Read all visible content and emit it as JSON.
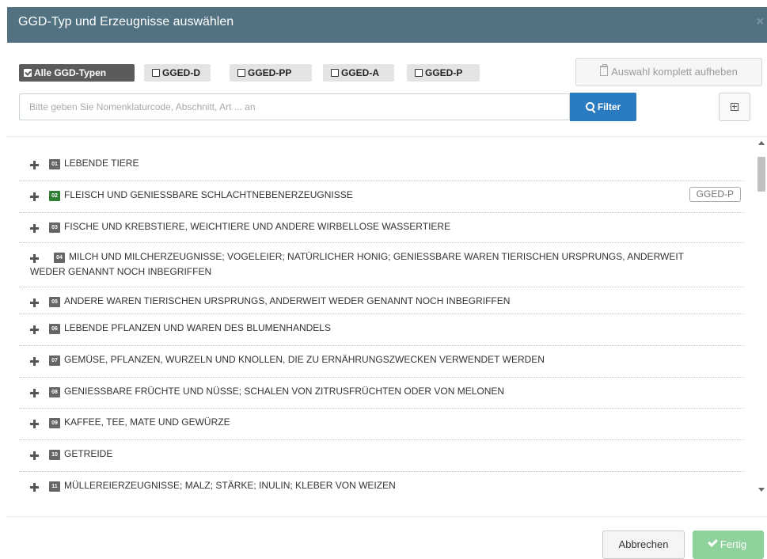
{
  "header": {
    "title": "GGD-Typ und Erzeugnisse auswählen",
    "close": "×"
  },
  "filters": {
    "chips": [
      {
        "label": "Alle GGD-Typen",
        "checked": true
      },
      {
        "label": "GGED-D",
        "checked": false
      },
      {
        "label": "GGED-PP",
        "checked": false
      },
      {
        "label": "GGED-A",
        "checked": false
      },
      {
        "label": "GGED-P",
        "checked": false
      }
    ],
    "clear_all": "Auswahl komplett aufheben"
  },
  "search": {
    "placeholder": "Bitte geben Sie Nomenklaturcode, Abschnitt, Art ... an",
    "value": "",
    "filter_label": "Filter"
  },
  "items": [
    {
      "code": "01",
      "label": "LEBENDE TIERE",
      "code_color": "#666666"
    },
    {
      "code": "02",
      "label": "FLEISCH UND GENIESSBARE SCHLACHTNEBENERZEUGNISSE",
      "code_color": "#2e7d32",
      "tag": "GGED-P"
    },
    {
      "code": "03",
      "label": "FISCHE UND KREBSTIERE, WEICHTIERE UND ANDERE WIRBELLOSE WASSERTIERE"
    },
    {
      "code": "04",
      "label": "MILCH UND MILCHERZEUGNISSE; VOGELEIER; NATÜRLICHER HONIG; GENIESSBARE WAREN TIERISCHEN URSPRUNGS, ANDERWEIT WEDER GENANNT NOCH INBEGRIFFEN"
    },
    {
      "code": "05",
      "label": "ANDERE WAREN TIERISCHEN URSPRUNGS, ANDERWEIT WEDER GENANNT NOCH INBEGRIFFEN"
    },
    {
      "code": "06",
      "label": "LEBENDE PFLANZEN UND WAREN DES BLUMENHANDELS"
    },
    {
      "code": "07",
      "label": "GEMÜSE, PFLANZEN, WURZELN UND KNOLLEN, DIE ZU ERNÄHRUNGSZWECKEN VERWENDET WERDEN"
    },
    {
      "code": "08",
      "label": "GENIESSBARE FRÜCHTE UND NÜSSE; SCHALEN VON ZITRUSFRÜCHTEN ODER VON MELONEN"
    },
    {
      "code": "09",
      "label": "KAFFEE, TEE, MATE UND GEWÜRZE"
    },
    {
      "code": "10",
      "label": "GETREIDE"
    },
    {
      "code": "11",
      "label": "MÜLLEREIERZEUGNISSE; MALZ; STÄRKE; INULIN; KLEBER VON WEIZEN"
    }
  ],
  "footer": {
    "cancel": "Abbrechen",
    "done": "Fertig"
  },
  "colors": {
    "header_bg": "#527281",
    "primary": "#2a7bbf",
    "success": "#8fd29c",
    "chip_active": "#5b5b5b"
  }
}
